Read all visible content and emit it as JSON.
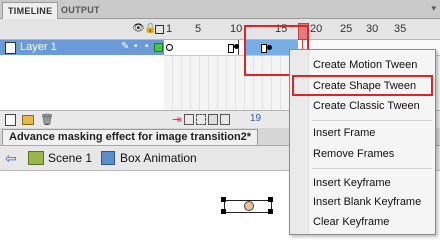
{
  "tabs": {
    "timeline": "TIMELINE",
    "output": "OUTPUT"
  },
  "header": {
    "frame_numbers": [
      "1",
      "5",
      "10",
      "15",
      "20",
      "25",
      "30",
      "35"
    ]
  },
  "layer": {
    "name": "Layer 1"
  },
  "timeline_footer": {
    "current_frame": "19"
  },
  "document": {
    "title": "Advance masking effect for image transition2*"
  },
  "edit_bar": {
    "scene_label": "Scene 1",
    "symbol_label": "Box Animation"
  },
  "context_menu": {
    "items": [
      "Create Motion Tween",
      "Create Shape Tween",
      "Create Classic Tween",
      "Insert Frame",
      "Remove Frames",
      "Insert Keyframe",
      "Insert Blank Keyframe",
      "Clear Keyframe"
    ],
    "highlighted": "Create Shape Tween"
  },
  "colors": {
    "layer_selected": "#6a9ad8",
    "frame_selected": "#78aee6",
    "playhead": "#e77b7b",
    "annotation": "#d8262b"
  }
}
